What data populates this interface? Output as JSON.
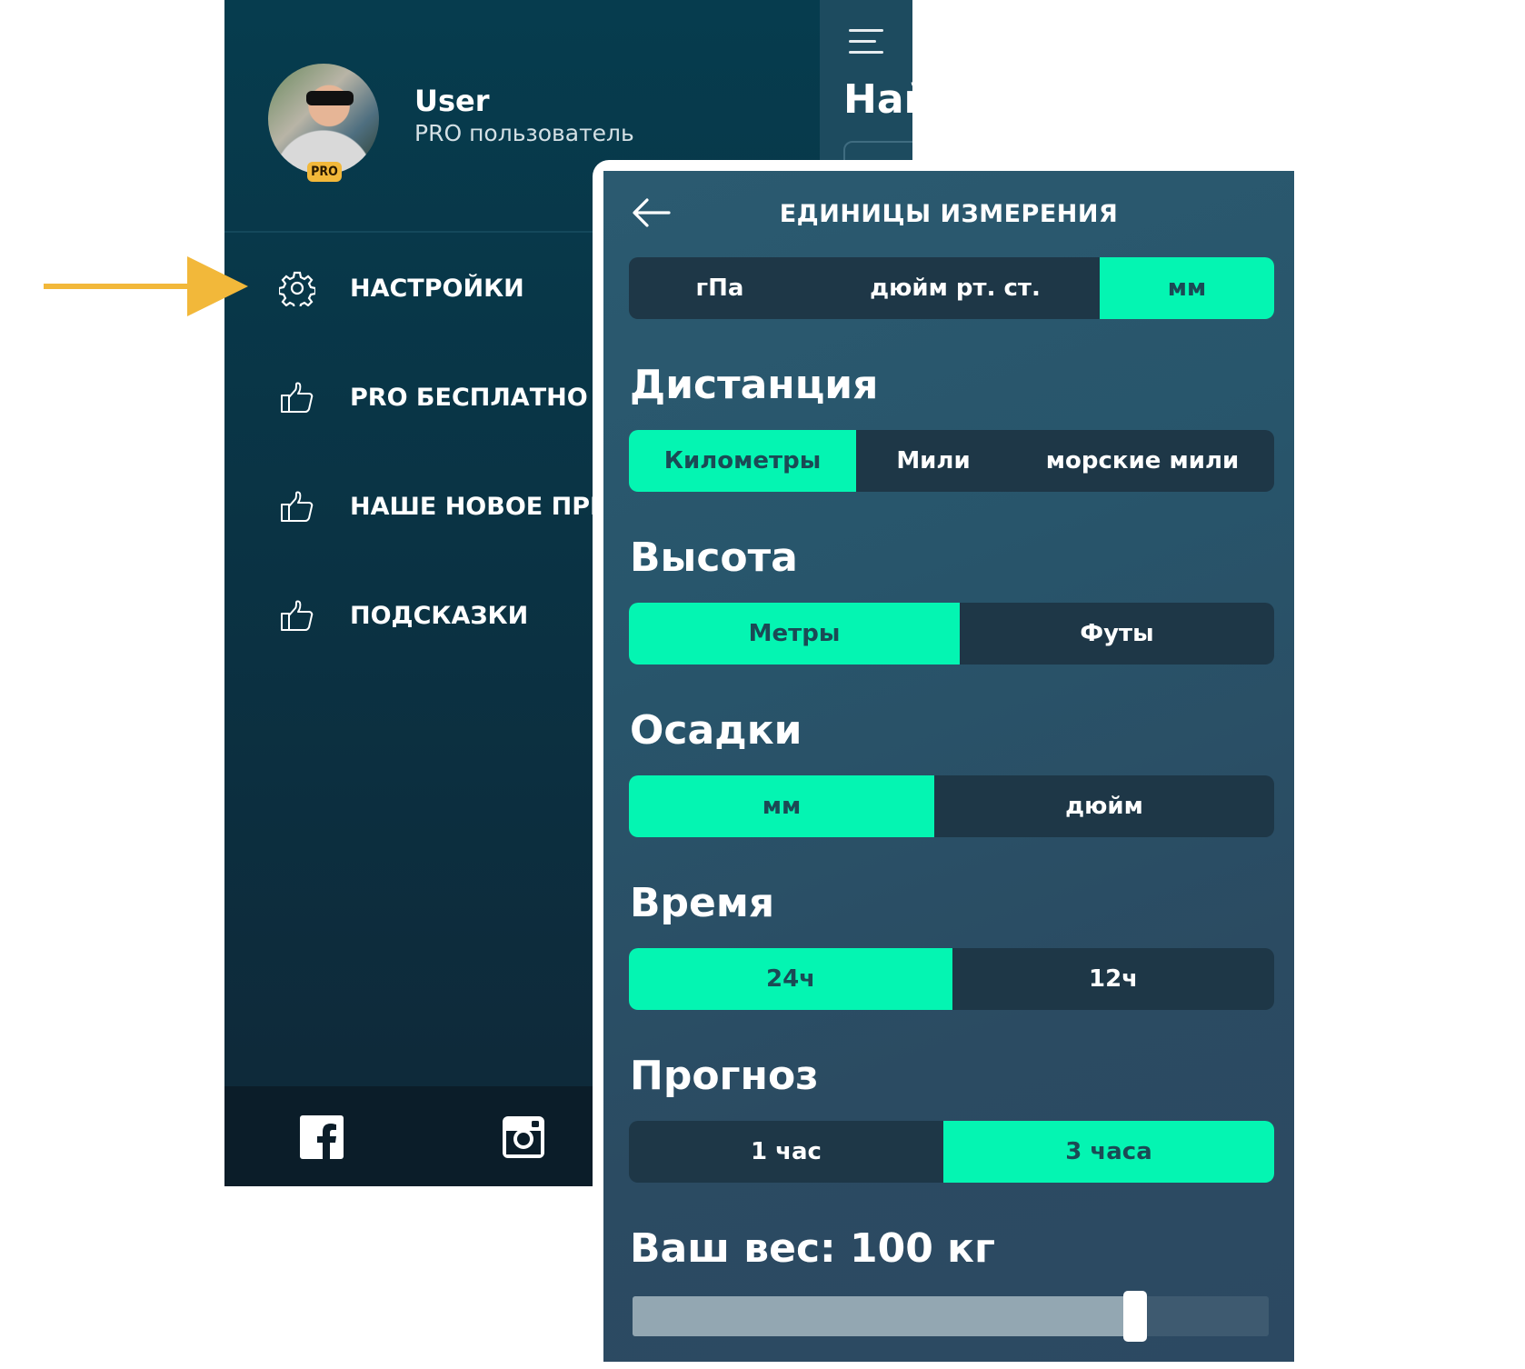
{
  "drawer": {
    "main_peek_title": "Най",
    "user": {
      "name": "User",
      "status": "PRO пользователь",
      "badge": "PRO"
    },
    "menu": [
      {
        "label": "НАСТРОЙКИ",
        "icon": "gear-icon"
      },
      {
        "label": "PRO БЕСПЛАТНО Н",
        "icon": "thumbs-up-icon"
      },
      {
        "label": "НАШЕ НОВОЕ ПРИЛ",
        "icon": "thumbs-up-icon"
      },
      {
        "label": "ПОДСКАЗКИ",
        "icon": "thumbs-up-icon"
      }
    ],
    "footer": [
      "facebook-icon",
      "instagram-icon"
    ]
  },
  "settings": {
    "title": "ЕДИНИЦЫ ИЗМЕРЕНИЯ",
    "pressure": {
      "options": [
        "гПа",
        "дюйм рт. ст.",
        "мм"
      ],
      "selected": 2
    },
    "distance": {
      "title": "Дистанция",
      "options": [
        "Километры",
        "Мили",
        "морские мили"
      ],
      "selected": 0
    },
    "height": {
      "title": "Высота",
      "options": [
        "Метры",
        "Футы"
      ],
      "selected": 0
    },
    "precipitation": {
      "title": "Осадки",
      "options": [
        "мм",
        "дюйм"
      ],
      "selected": 0
    },
    "time": {
      "title": "Время",
      "options": [
        "24ч",
        "12ч"
      ],
      "selected": 0
    },
    "forecast": {
      "title": "Прогноз",
      "options": [
        "1 час",
        "3 часа"
      ],
      "selected": 1
    },
    "weight": {
      "title": "Ваш вес: 100 кг",
      "slider_fraction": 0.79
    }
  },
  "colors": {
    "accent": "#04f5b2",
    "arrow": "#f2b83a",
    "drawer_bg": "#063c4e",
    "panel_bg": "#2b5a70"
  }
}
